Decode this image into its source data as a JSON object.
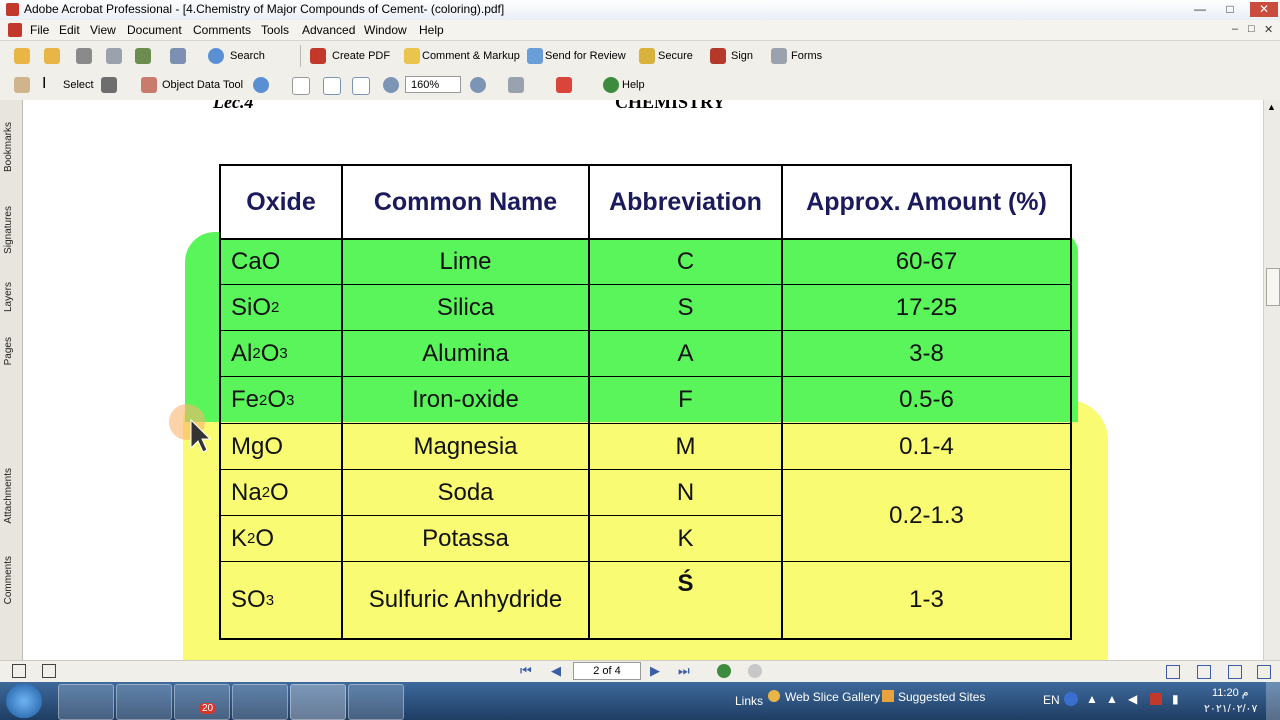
{
  "window": {
    "title": "Adobe Acrobat Professional - [4.Chemistry of Major Compounds of    Cement- (coloring).pdf]",
    "min_label": "—",
    "max_label": "□",
    "close_label": "✕"
  },
  "menu": {
    "items": [
      "File",
      "Edit",
      "View",
      "Document",
      "Comments",
      "Tools",
      "Advanced",
      "Window",
      "Help"
    ],
    "sub_controls": [
      "–",
      "□",
      "✕"
    ]
  },
  "toolbar1": {
    "search": "Search",
    "create_pdf": "Create PDF",
    "comment_markup": "Comment & Markup",
    "send_review": "Send for Review",
    "secure": "Secure",
    "sign": "Sign",
    "forms": "Forms"
  },
  "toolbar2": {
    "select": "Select",
    "object_data_tool": "Object Data Tool",
    "zoom_value": "160%",
    "help": "Help"
  },
  "left_tabs": [
    "Bookmarks",
    "Signatures",
    "Layers",
    "Pages",
    "Attachments",
    "Comments"
  ],
  "document": {
    "left_heading": "Lec.4",
    "center_heading": "CHEMISTRY",
    "table": {
      "headers": [
        "Oxide",
        "Common Name",
        "Abbreviation",
        "Approx. Amount (%)"
      ],
      "rows": [
        {
          "oxide": "CaO",
          "name": "Lime",
          "abbr": "C",
          "amount": "60-67"
        },
        {
          "oxide": "SiO",
          "sub": "2",
          "name": "Silica",
          "abbr": "S",
          "amount": "17-25"
        },
        {
          "oxide_pre": "Al",
          "sub1": "2",
          "oxide_mid": "O",
          "sub2": "3",
          "name": "Alumina",
          "abbr": "A",
          "amount": "3-8"
        },
        {
          "oxide_pre": "Fe",
          "sub1": "2",
          "oxide_mid": "O",
          "sub2": "3",
          "name": "Iron-oxide",
          "abbr": "F",
          "amount": "0.5-6"
        },
        {
          "oxide": "MgO",
          "name": "Magnesia",
          "abbr": "M",
          "amount": "0.1-4"
        },
        {
          "oxide_pre": "Na",
          "sub1": "2",
          "oxide_mid": "O",
          "name": "Soda",
          "abbr": "N",
          "amount": "0.2-1.3"
        },
        {
          "oxide_pre": "K",
          "sub1": "2",
          "oxide_mid": "O",
          "name": "Potassa",
          "abbr": "K"
        },
        {
          "oxide": "SO",
          "sub": "3",
          "name": "Sulfuric Anhydride",
          "abbr": "Ś",
          "amount": "1-3"
        }
      ]
    }
  },
  "navbar": {
    "page_indicator": "2 of 4"
  },
  "taskbar": {
    "badge_count": "20",
    "links_label": "Links",
    "web_slice": "Web Slice Gallery",
    "suggested": "Suggested Sites",
    "lang": "EN",
    "time": "11:20 م",
    "date": "٢٠٢١/٠٢/٠٧"
  },
  "colors": {
    "green_highlight": "#5af55a",
    "yellow_highlight": "#f9fb72",
    "header_text": "#1a1a5c"
  }
}
